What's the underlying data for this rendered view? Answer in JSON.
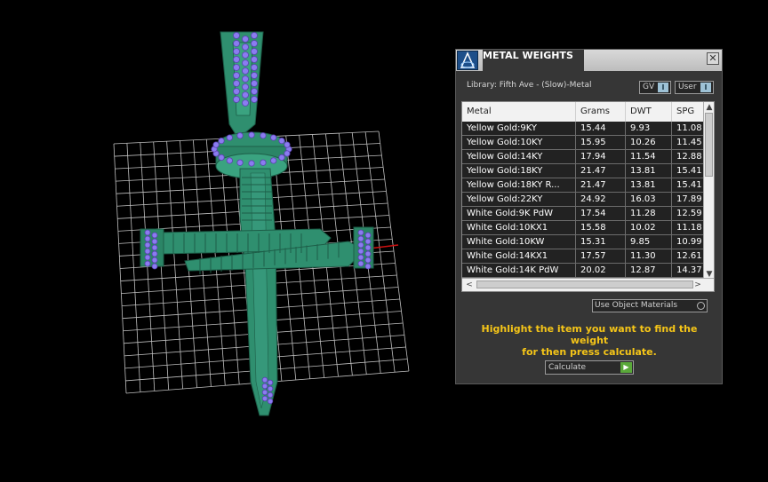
{
  "panel": {
    "title": "METAL WEIGHTS",
    "close_glyph": "✕",
    "library_label": "Library: Fifth Ave - (Slow)-Metal",
    "gv_label": "GV",
    "user_label": "User",
    "toggle_glyph": "I",
    "use_object_materials": "Use Object Materials",
    "hint_line1": "Highlight the item you want to find the weight",
    "hint_line2": "for then press calculate.",
    "calculate_label": "Calculate",
    "calculate_glyph": "▶",
    "scroll_up": "▲",
    "scroll_down": "▼",
    "scroll_left": "<",
    "scroll_right": ">"
  },
  "table": {
    "headers": [
      "Metal",
      "Grams",
      "DWT",
      "SPG"
    ],
    "rows": [
      [
        "Yellow Gold:9KY",
        "15.44",
        "9.93",
        "11.08"
      ],
      [
        "Yellow Gold:10KY",
        "15.95",
        "10.26",
        "11.45"
      ],
      [
        "Yellow Gold:14KY",
        "17.94",
        "11.54",
        "12.88"
      ],
      [
        "Yellow Gold:18KY",
        "21.47",
        "13.81",
        "15.41"
      ],
      [
        "Yellow Gold:18KY R...",
        "21.47",
        "13.81",
        "15.41"
      ],
      [
        "Yellow Gold:22KY",
        "24.92",
        "16.03",
        "17.89"
      ],
      [
        "White Gold:9K PdW",
        "17.54",
        "11.28",
        "12.59"
      ],
      [
        "White Gold:10KX1",
        "15.58",
        "10.02",
        "11.18"
      ],
      [
        "White Gold:10KW",
        "15.31",
        "9.85",
        "10.99"
      ],
      [
        "White Gold:14KX1",
        "17.57",
        "11.30",
        "12.61"
      ],
      [
        "White Gold:14K PdW",
        "20.02",
        "12.87",
        "14.37"
      ]
    ]
  },
  "viewport": {
    "icons": [
      "grid-floor",
      "cross-pendant-model",
      "diamond-gems"
    ],
    "colors": {
      "metal": "#2f8f6f",
      "gems": "#8a7cf0",
      "grid": "#c8c8c8",
      "axis": "#cc1111"
    }
  },
  "colors": {
    "hint": "#f5c518",
    "panel_bg": "#363636",
    "calc_icon": "#5aa83a"
  }
}
